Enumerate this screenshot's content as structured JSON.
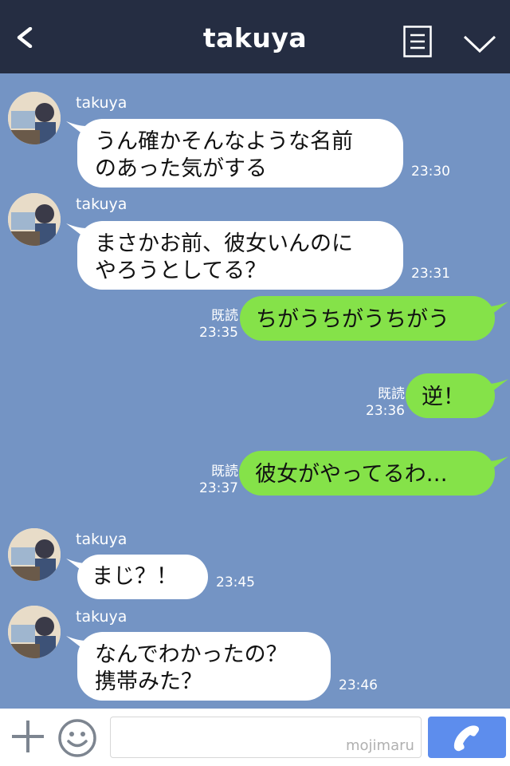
{
  "header": {
    "title": "takuya"
  },
  "messages": [
    {
      "sender": "takuya",
      "lines": [
        "うん確かそんなような名前",
        "のあった気がする"
      ],
      "time": "23:30"
    },
    {
      "sender": "takuya",
      "lines": [
        "まさかお前、彼女いんのに",
        "やろうとしてる？"
      ],
      "time": "23:31"
    },
    {
      "read": "既読",
      "text": "ちがうちがうちがう",
      "time": "23:35"
    },
    {
      "read": "既読",
      "text": "逆！",
      "time": "23:36"
    },
    {
      "read": "既読",
      "text": "彼女がやってるわ…",
      "time": "23:37"
    },
    {
      "sender": "takuya",
      "lines": [
        "まじ？！"
      ],
      "time": "23:45"
    },
    {
      "sender": "takuya",
      "lines": [
        "なんでわかったの？",
        "携帯みた？"
      ],
      "time": "23:46"
    }
  ],
  "footer": {
    "watermark": "mojimaru",
    "input_value": ""
  },
  "colors": {
    "header": "#252d42",
    "chat_bg": "#7494c4",
    "outgoing_bubble": "#85e249",
    "incoming_bubble": "#ffffff",
    "call_button": "#5d8ded"
  },
  "icons": [
    "back-arrow-icon",
    "memo-list-icon",
    "chevron-down-icon",
    "plus-icon",
    "smile-icon",
    "phone-icon"
  ]
}
